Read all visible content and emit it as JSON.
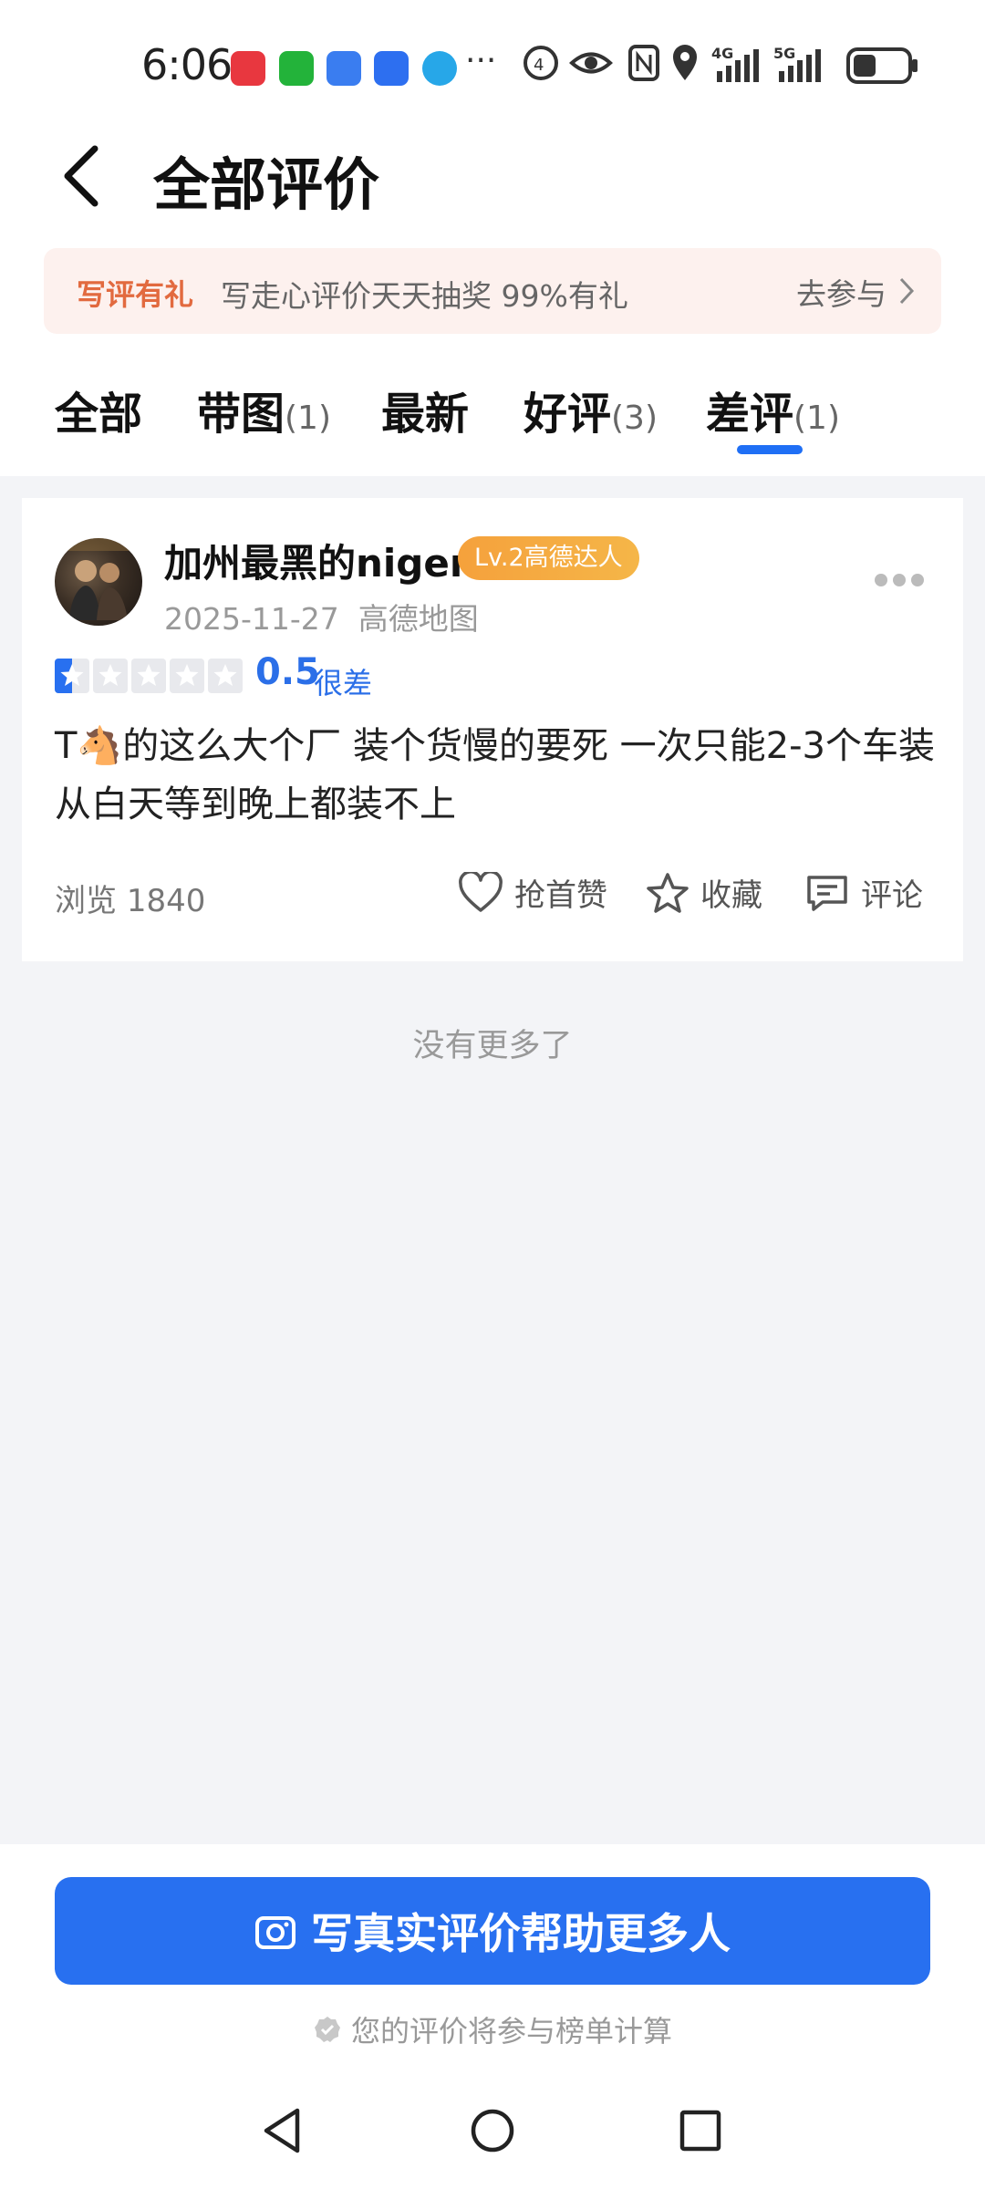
{
  "status_bar": {
    "time": "6:06",
    "overflow": "···",
    "network_labels": [
      "4G",
      "5G"
    ],
    "apps": [
      {
        "name": "huawei-appgallery",
        "color": "#e8373f"
      },
      {
        "name": "wechat",
        "color": "#23b33a"
      },
      {
        "name": "transfer-app",
        "color": "#3a7df0"
      },
      {
        "name": "voice-app",
        "color": "#2d6ff0"
      },
      {
        "name": "browser-app",
        "color": "#27a7e8"
      }
    ]
  },
  "header": {
    "title": "全部评价",
    "back_icon": "chevron-left-icon"
  },
  "banner": {
    "tag": "写评有礼",
    "text": "写走心评价天天抽奖 99%有礼",
    "action": "去参与"
  },
  "tabs": [
    {
      "label": "全部",
      "count": ""
    },
    {
      "label": "带图",
      "count": "(1)"
    },
    {
      "label": "最新",
      "count": ""
    },
    {
      "label": "好评",
      "count": "(3)"
    },
    {
      "label": "差评",
      "count": "(1)"
    }
  ],
  "active_tab_index": 4,
  "colors": {
    "accent": "#2870f0",
    "banner_tag": "#e26a3f",
    "badge": "#f5a13c"
  },
  "review": {
    "user_name": "加州最黑的niger",
    "level_badge": "Lv.2高德达人",
    "date": "2025-11-27",
    "source": "高德地图",
    "rating": 0.5,
    "rating_score": "0.5",
    "rating_text": "很差",
    "content": "T🐴的这么大个厂  装个货慢的要死  一次只能2-3个车装  从白天等到晚上都装不上",
    "views_label": "浏览",
    "views": "1840",
    "like_label": "抢首赞",
    "favorite_label": "收藏",
    "comment_label": "评论"
  },
  "no_more_text": "没有更多了",
  "write_button": "写真实评价帮助更多人",
  "rank_note": "您的评价将参与榜单计算"
}
